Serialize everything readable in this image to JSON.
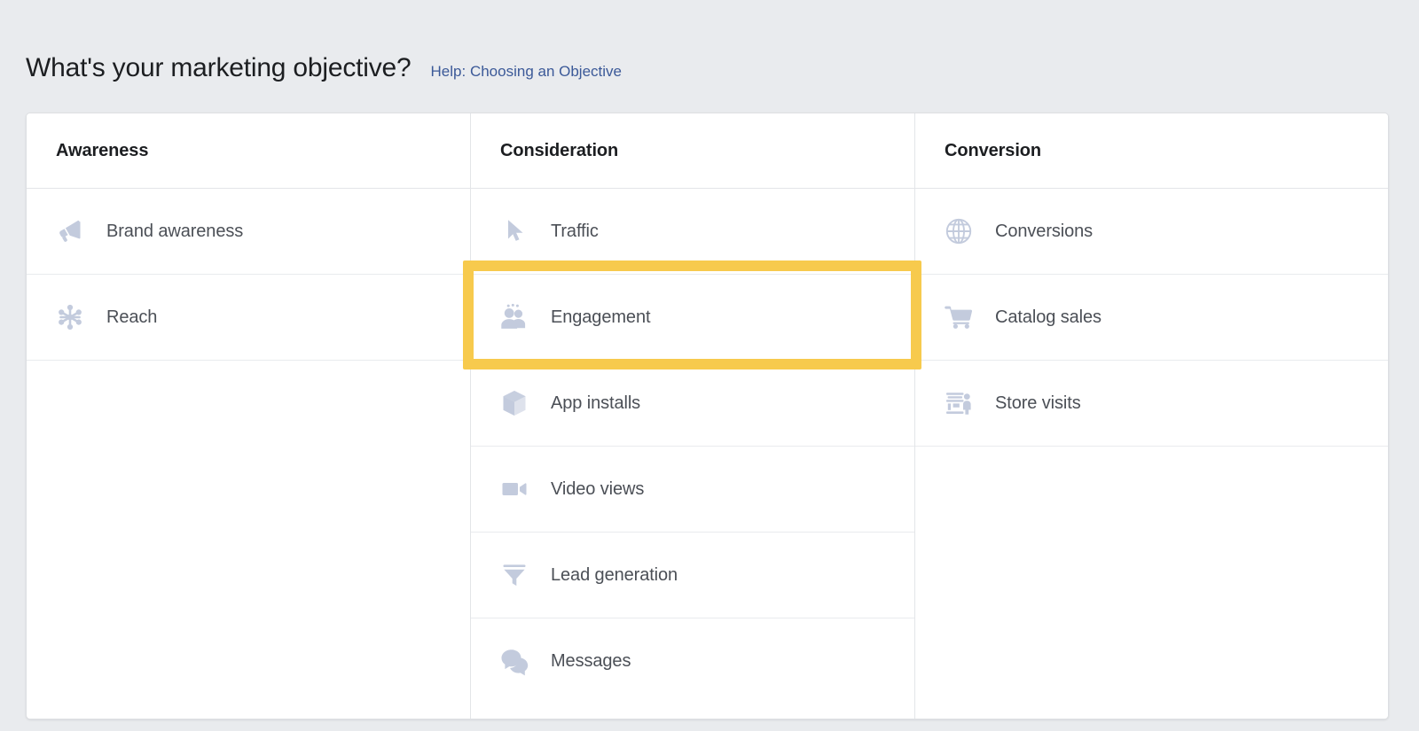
{
  "page": {
    "title": "What's your marketing objective?",
    "help_link": "Help: Choosing an Objective",
    "link_color": "#3b5998",
    "background_color": "#e9ebee",
    "card_background": "#ffffff",
    "icon_color": "#c3cbdd",
    "label_color": "#4b4f56",
    "highlight_color": "#f7ca4d"
  },
  "columns": [
    {
      "header": "Awareness",
      "items": [
        {
          "label": "Brand awareness",
          "icon": "megaphone-icon"
        },
        {
          "label": "Reach",
          "icon": "reach-star-icon"
        }
      ]
    },
    {
      "header": "Consideration",
      "items": [
        {
          "label": "Traffic",
          "icon": "cursor-arrow-icon"
        },
        {
          "label": "Engagement",
          "icon": "people-group-icon"
        },
        {
          "label": "App installs",
          "icon": "cube-icon"
        },
        {
          "label": "Video views",
          "icon": "video-camera-icon"
        },
        {
          "label": "Lead generation",
          "icon": "funnel-icon"
        },
        {
          "label": "Messages",
          "icon": "speech-bubbles-icon"
        }
      ]
    },
    {
      "header": "Conversion",
      "items": [
        {
          "label": "Conversions",
          "icon": "globe-icon"
        },
        {
          "label": "Catalog sales",
          "icon": "shopping-cart-icon"
        },
        {
          "label": "Store visits",
          "icon": "storefront-icon"
        }
      ]
    }
  ],
  "annotation": {
    "target": "Engagement",
    "type": "highlight-rectangle"
  }
}
